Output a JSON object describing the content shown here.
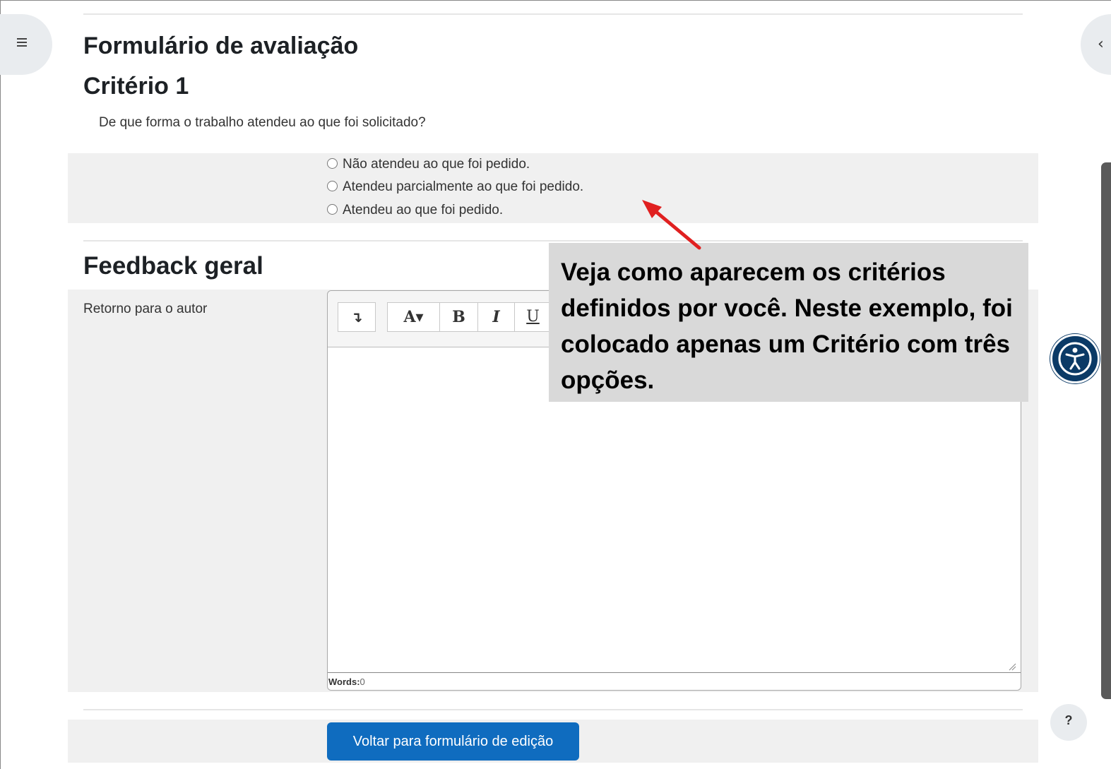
{
  "page": {
    "form_title": "Formulário de avaliação",
    "criterion_title": "Critério 1",
    "question": "De que forma o trabalho atendeu ao que foi solicitado?",
    "options": [
      "Não atendeu ao que foi pedido.",
      "Atendeu parcialmente ao que foi pedido.",
      "Atendeu ao que foi pedido."
    ],
    "feedback_title": "Feedback geral",
    "feedback_label": "Retorno para o autor",
    "back_button_label": "Voltar para formulário de edição"
  },
  "editor": {
    "toolbar": [
      {
        "name": "collapse-toolbar-button",
        "label": "↴"
      },
      {
        "name": "font-style-dropdown",
        "label": "A▾"
      },
      {
        "name": "bold-button",
        "label": "B"
      },
      {
        "name": "italic-button",
        "label": "I"
      },
      {
        "name": "underline-button",
        "label": "U"
      }
    ],
    "words_label": "Words:",
    "words_count": "0"
  },
  "callout": {
    "text": "Veja como aparecem os critérios definidos por você. Neste exemplo, foi colocado apenas um Critério com três opções."
  },
  "widgets": {
    "help_label": "?",
    "right_drawer_chevron": "‹"
  },
  "icons": {
    "left_drawer": "list-icon",
    "right_drawer": "chevron-left-icon",
    "accessibility": "accessibility-icon",
    "help": "question-icon"
  },
  "colors": {
    "primary": "#0f6cbf",
    "callout_bg": "#d9d9d9",
    "arrow": "#e02020",
    "accessibility_bg": "#0b3a66"
  }
}
